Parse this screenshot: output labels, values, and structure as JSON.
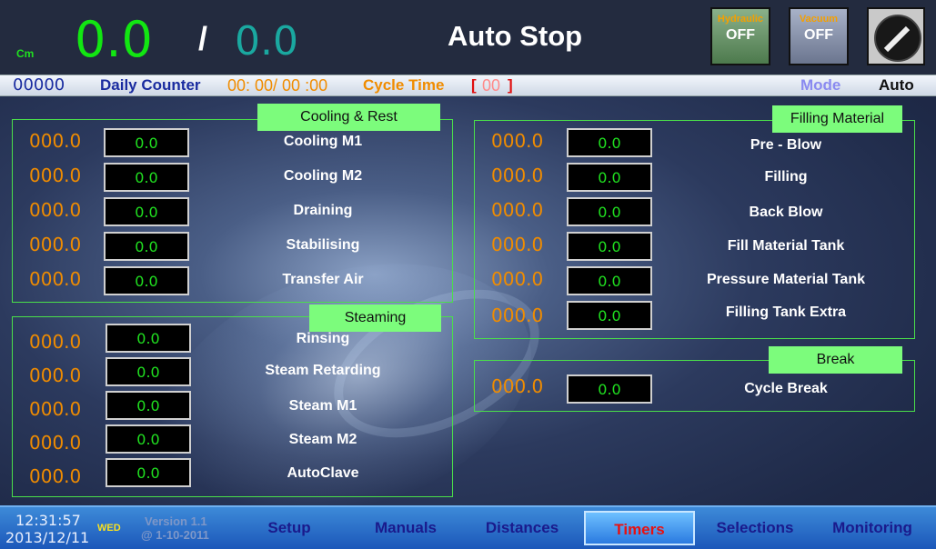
{
  "header": {
    "unit": "Cm",
    "value1": "0.0",
    "separator": "/",
    "value2": "0.0",
    "status": "Auto Stop",
    "hydraulic": {
      "label": "Hydraulic",
      "value": "OFF"
    },
    "vacuum": {
      "label": "Vacuum",
      "value": "OFF"
    }
  },
  "info_bar": {
    "counter": "00000",
    "counter_label": "Daily Counter",
    "cycle_time_value": "00: 00/ 00 :00",
    "cycle_time_label": "Cycle Time",
    "bracket_open": "[",
    "bracket_value": "00",
    "bracket_close": "]",
    "mode_label": "Mode",
    "mode_value": "Auto"
  },
  "panels": {
    "cooling": {
      "title": "Cooling & Rest",
      "rows": [
        {
          "preset": "000.0",
          "value": "0.0",
          "label": "Cooling M1"
        },
        {
          "preset": "000.0",
          "value": "0.0",
          "label": "Cooling M2"
        },
        {
          "preset": "000.0",
          "value": "0.0",
          "label": "Draining"
        },
        {
          "preset": "000.0",
          "value": "0.0",
          "label": "Stabilising"
        },
        {
          "preset": "000.0",
          "value": "0.0",
          "label": "Transfer Air"
        }
      ]
    },
    "steaming": {
      "title": "Steaming",
      "rows": [
        {
          "preset": "000.0",
          "value": "0.0",
          "label": "Rinsing"
        },
        {
          "preset": "000.0",
          "value": "0.0",
          "label": "Steam Retarding"
        },
        {
          "preset": "000.0",
          "value": "0.0",
          "label": "Steam M1"
        },
        {
          "preset": "000.0",
          "value": "0.0",
          "label": "Steam M2"
        },
        {
          "preset": "000.0",
          "value": "0.0",
          "label": "AutoClave"
        }
      ]
    },
    "filling": {
      "title": "Filling Material",
      "rows": [
        {
          "preset": "000.0",
          "value": "0.0",
          "label": "Pre - Blow"
        },
        {
          "preset": "000.0",
          "value": "0.0",
          "label": "Filling"
        },
        {
          "preset": "000.0",
          "value": "0.0",
          "label": "Back Blow"
        },
        {
          "preset": "000.0",
          "value": "0.0",
          "label": "Fill Material Tank"
        },
        {
          "preset": "000.0",
          "value": "0.0",
          "label": "Pressure Material Tank"
        },
        {
          "preset": "000.0",
          "value": "0.0",
          "label": "Filling Tank Extra"
        }
      ]
    },
    "break": {
      "title": "Break",
      "rows": [
        {
          "preset": "000.0",
          "value": "0.0",
          "label": "Cycle Break"
        }
      ]
    }
  },
  "footer": {
    "time": "12:31:57",
    "date": "2013/12/11",
    "weekday": "WED",
    "version": "Version 1.1",
    "version_date": "@ 1-10-2011",
    "tabs": [
      {
        "label": "Setup",
        "active": false
      },
      {
        "label": "Manuals",
        "active": false
      },
      {
        "label": "Distances",
        "active": false
      },
      {
        "label": "Timers",
        "active": true
      },
      {
        "label": "Selections",
        "active": false
      },
      {
        "label": "Monitoring",
        "active": false
      }
    ]
  },
  "colors": {
    "accent_green": "#7cfc7c",
    "preset_orange": "#f08c00",
    "active_tab_text": "#e81010"
  },
  "icons": {
    "selector_knob": "rotary-switch-icon"
  }
}
